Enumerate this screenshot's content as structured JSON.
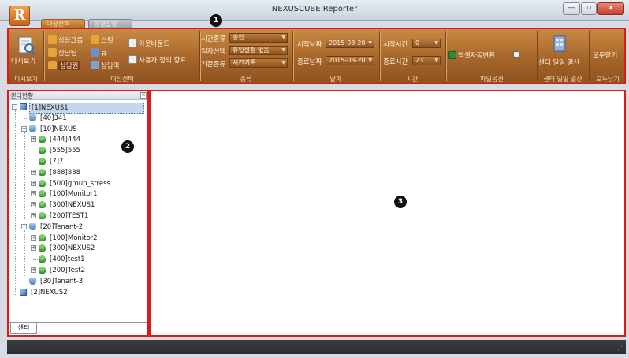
{
  "window": {
    "title": "NEXUSCUBE Reporter",
    "logo_letter": "R",
    "minimize": "—",
    "maximize": "▫",
    "close": "x"
  },
  "tabs": [
    {
      "label": "대상선택"
    },
    {
      "label": "환경설정"
    }
  ],
  "badges": [
    "1",
    "2",
    "3"
  ],
  "ribbon": {
    "refresh": {
      "label": "다시보기",
      "group": "다시보기"
    },
    "target": {
      "items": [
        "상담그룹",
        "상담팀",
        "상담원",
        "스킬",
        "큐",
        "상담미",
        "아웃바운드",
        "사용자 정의 항표"
      ],
      "group": "대상선택"
    },
    "type": {
      "rows": [
        {
          "label": "시간종류",
          "value": "총합"
        },
        {
          "label": "일자선택",
          "value": "휴일설정 없음"
        },
        {
          "label": "기준종류",
          "value": "시간기준"
        }
      ],
      "group": "종류"
    },
    "date": {
      "start_label": "시작날짜",
      "start_value": "2015-03-20",
      "end_label": "종료날짜",
      "end_value": "2015-03-20",
      "group": "날짜"
    },
    "time": {
      "start_label": "시작시간",
      "start_value": "0",
      "end_label": "종료시간",
      "end_value": "23",
      "group": "시간"
    },
    "file": {
      "label": "엑셀자동변환",
      "group": "파일옵션"
    },
    "center": {
      "label": "센터 일일 결산",
      "group": "센터 일일 결산"
    },
    "closeall": {
      "label": "모두닫기",
      "group": "모두닫기"
    }
  },
  "left_panel": {
    "header": "센터현황",
    "close_glyph": "×",
    "bottom_tab": "센터",
    "tree": [
      {
        "label": "[1]NEXUS1",
        "level": 0,
        "type": "cube",
        "expander": "−",
        "selected": true
      },
      {
        "label": "[40]341",
        "level": 1,
        "type": "db",
        "expander": ""
      },
      {
        "label": "[10]NEXUS",
        "level": 1,
        "type": "db",
        "expander": "−"
      },
      {
        "label": "[444]444",
        "level": 2,
        "type": "agent",
        "expander": "+"
      },
      {
        "label": "[555]555",
        "level": 2,
        "type": "agent",
        "expander": ""
      },
      {
        "label": "[7]7",
        "level": 2,
        "type": "agent",
        "expander": ""
      },
      {
        "label": "[888]888",
        "level": 2,
        "type": "agent",
        "expander": "+"
      },
      {
        "label": "[500]group_stress",
        "level": 2,
        "type": "agent",
        "expander": "+"
      },
      {
        "label": "[100]Monitor1",
        "level": 2,
        "type": "agent",
        "expander": "+"
      },
      {
        "label": "[300]NEXUS1",
        "level": 2,
        "type": "agent",
        "expander": "+"
      },
      {
        "label": "[200]TEST1",
        "level": 2,
        "type": "agent",
        "expander": "+"
      },
      {
        "label": "[20]Tenant-2",
        "level": 1,
        "type": "db",
        "expander": "−"
      },
      {
        "label": "[100]Monitor2",
        "level": 2,
        "type": "agent",
        "expander": "+"
      },
      {
        "label": "[300]NEXUS2",
        "level": 2,
        "type": "agent",
        "expander": "+"
      },
      {
        "label": "[400]test1",
        "level": 2,
        "type": "agent",
        "expander": ""
      },
      {
        "label": "[200]Test2",
        "level": 2,
        "type": "agent",
        "expander": "+"
      },
      {
        "label": "[30]Tenant-3",
        "level": 1,
        "type": "db",
        "expander": ""
      },
      {
        "label": "[2]NEXUS2",
        "level": 0,
        "type": "cube",
        "expander": ""
      }
    ]
  },
  "colors": {
    "ribbon": "#a6652a",
    "highlight_border": "#e01818",
    "selected_row": "#c4d6f0"
  }
}
